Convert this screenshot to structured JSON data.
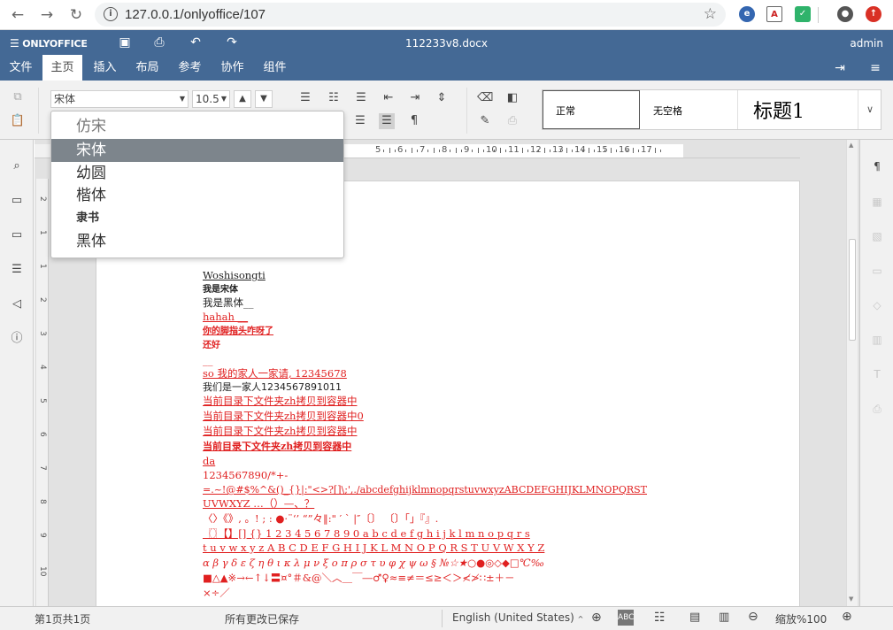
{
  "browser": {
    "url": "127.0.0.1/onlyoffice/107"
  },
  "app": {
    "logo_text": "ONLYOFFICE",
    "document_title": "112233v8.docx",
    "user": "admin"
  },
  "tabs": [
    {
      "label": "文件"
    },
    {
      "label": "主页"
    },
    {
      "label": "插入"
    },
    {
      "label": "布局"
    },
    {
      "label": "参考"
    },
    {
      "label": "协作"
    },
    {
      "label": "组件"
    }
  ],
  "toolbar": {
    "font_name": "宋体",
    "font_size": "10.5"
  },
  "styles": {
    "normal": "正常",
    "no_spacing": "无空格",
    "heading1": "标题1"
  },
  "font_menu": {
    "items": [
      "仿宋",
      "宋体",
      "幼圆",
      "楷体",
      "隶书",
      "黑体"
    ],
    "selected_index": 1
  },
  "ruler": {
    "h_ticks": [
      "5",
      "6",
      "7",
      "8",
      "9",
      "10",
      "11",
      "12",
      "13",
      "14",
      "15",
      "16",
      "17"
    ],
    "v_ticks": [
      "2",
      "1",
      "1",
      "2",
      "3",
      "4",
      "5",
      "6",
      "7",
      "8",
      "9",
      "10"
    ]
  },
  "document": {
    "lines": [
      "Woshisongti",
      "我是宋体",
      "我是黑体__",
      "hahah  __",
      "你的脚指头咋呀了  ",
      "还好",
      "__",
      "so  我的家人一家请, 12345678",
      "我们是一家人1234567891011",
      "当前目录下文件夹zh拷贝到容器中",
      "当前目录下文件夹zh拷贝到容器中0",
      "当前目录下文件夹zh拷贝到容器中",
      "当前目录下文件夹zh拷贝到容器中",
      "da",
      "1234567890/*+-",
      "=.~!@#$%^&()_{}|:\"<>?[]\\;',./abcdefghijklmnopqrstuvwxyzABCDEFGHIJKLMNOPQRST",
      "UVWXYZ …（）—、？",
      "  〈〉《》, 。! ; : ●·¨‘’ “”々‖:\" ′ ` |″〔〕 〔〕「」『』.",
      "〖〗【】[] {} 1 2 3 4 5 6 7 8 9 0 a b c d e f g h i j k l m n o p q r s",
      " t u v w x y z A B C D E F G H I J K L M N O P Q R S T U V W X Y Z",
      " α β γ δ ε ζ η θ ι κ λ μ ν ξ ο π ρ σ τ υ φ χ ψ ω § №☆★○●◎◇◆□℃‰",
      "■△▲※→←↑↓〓¤°＃&@＼︿＿￣―♂♀≈≡≠＝≤≥＜＞≮≯∷±＋－",
      "×÷／"
    ]
  },
  "statusbar": {
    "page_info": "第1页共1页",
    "save_state": "所有更改已保存",
    "language": "English (United States)",
    "zoom": "缩放%100"
  },
  "colors": {
    "header_bg": "#446995",
    "accent_red": "#e02020",
    "menu_selected": "#7d858c"
  }
}
